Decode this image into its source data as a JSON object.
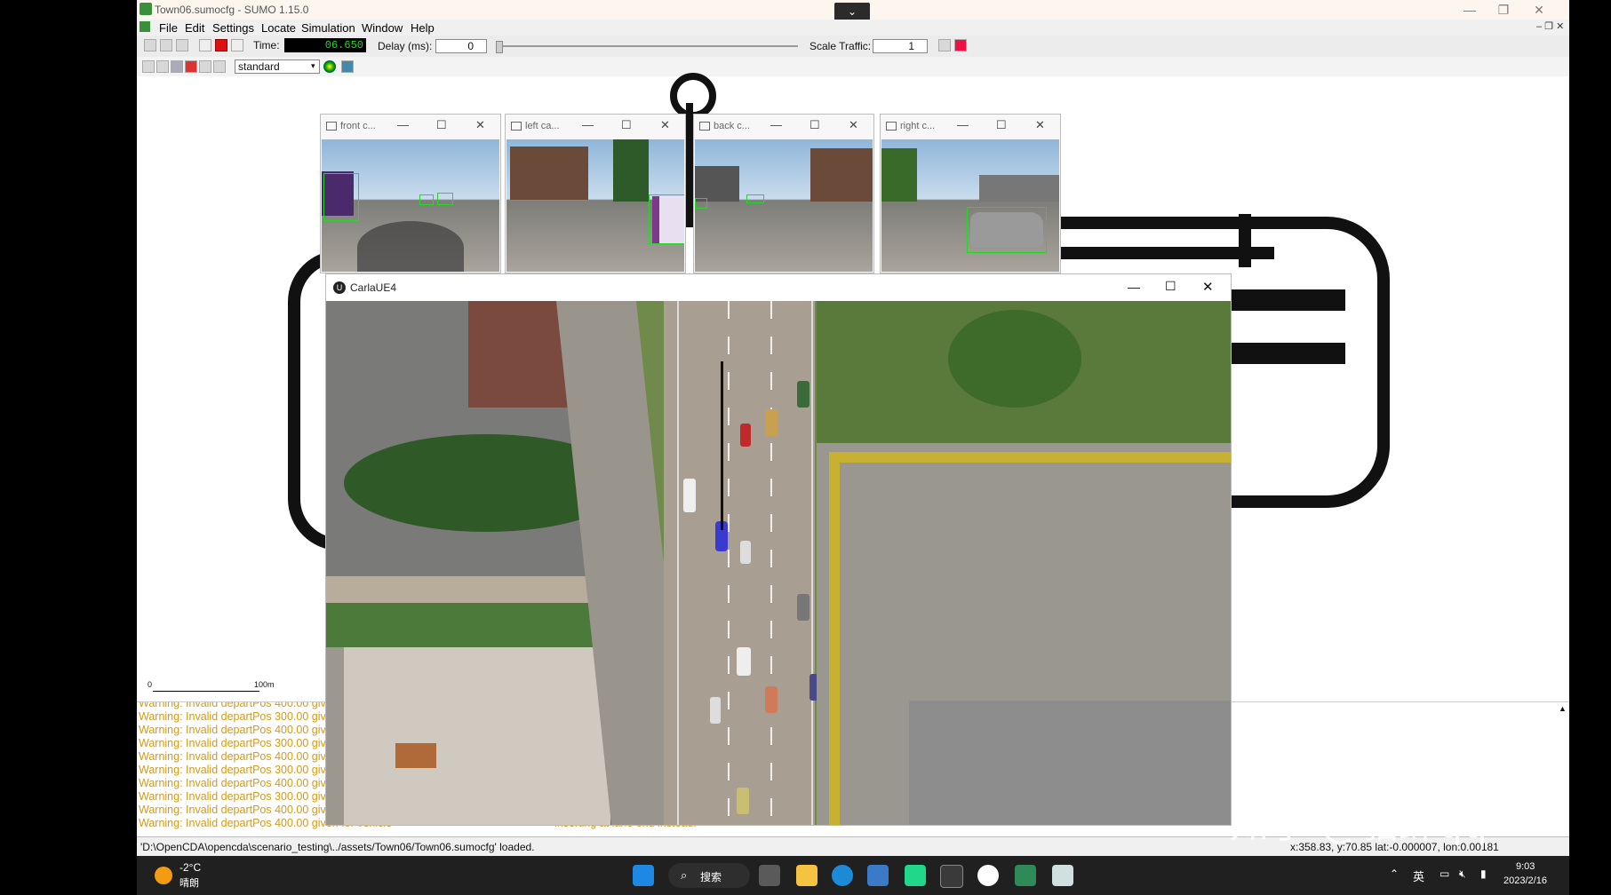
{
  "sumo_window": {
    "title": "Town06.sumocfg - SUMO 1.15.0",
    "minimize": "—",
    "restore": "❐",
    "close": "✕",
    "collapse_arrow": "⌄"
  },
  "menu": [
    "File",
    "Edit",
    "Settings",
    "Locate",
    "Simulation",
    "Window",
    "Help"
  ],
  "toolbar": {
    "time_label": "Time:",
    "time_value": "06.650",
    "delay_label": "Delay (ms):",
    "delay_value": "0",
    "scale_label": "Scale Traffic:",
    "scale_value": "1"
  },
  "view_toolbar": {
    "scheme_select": "standard"
  },
  "scale_bar": {
    "start": "0",
    "end": "100m"
  },
  "camera_windows": [
    {
      "title": "front c..."
    },
    {
      "title": "left ca..."
    },
    {
      "title": "back c..."
    },
    {
      "title": "right c..."
    }
  ],
  "carla_window": {
    "title": "CarlaUE4"
  },
  "log": {
    "lines": [
      "Warning: Invalid departPos 400.00 give",
      "Warning: Invalid departPos 300.00 give",
      "Warning: Invalid departPos 400.00 give",
      "Warning: Invalid departPos 300.00 give",
      "Warning: Invalid departPos 400.00 give",
      "Warning: Invalid departPos 300.00 give",
      "Warning: Invalid departPos 400.00 give",
      "Warning: Invalid departPos 300.00 give",
      "Warning: Invalid departPos 400.00 give",
      "Warning: Invalid departPos 400.00 given for vehicle"
    ],
    "log_tail": "inserting at lane end instead."
  },
  "status": {
    "message": "'D:\\OpenCDA\\opencda\\scenario_testing\\../assets/Town06/Town06.sumocfg' loaded.",
    "coords": "x:358.83, y:70.85  lat:-0.000007, lon:0.00181"
  },
  "watermark": "知乎 @貂蝉qq",
  "taskbar": {
    "weather_temp": "-2°C",
    "weather_desc": "晴朗",
    "search_label": "搜索",
    "ime": "英",
    "clock_time": "9:03",
    "clock_date": "2023/2/16"
  }
}
